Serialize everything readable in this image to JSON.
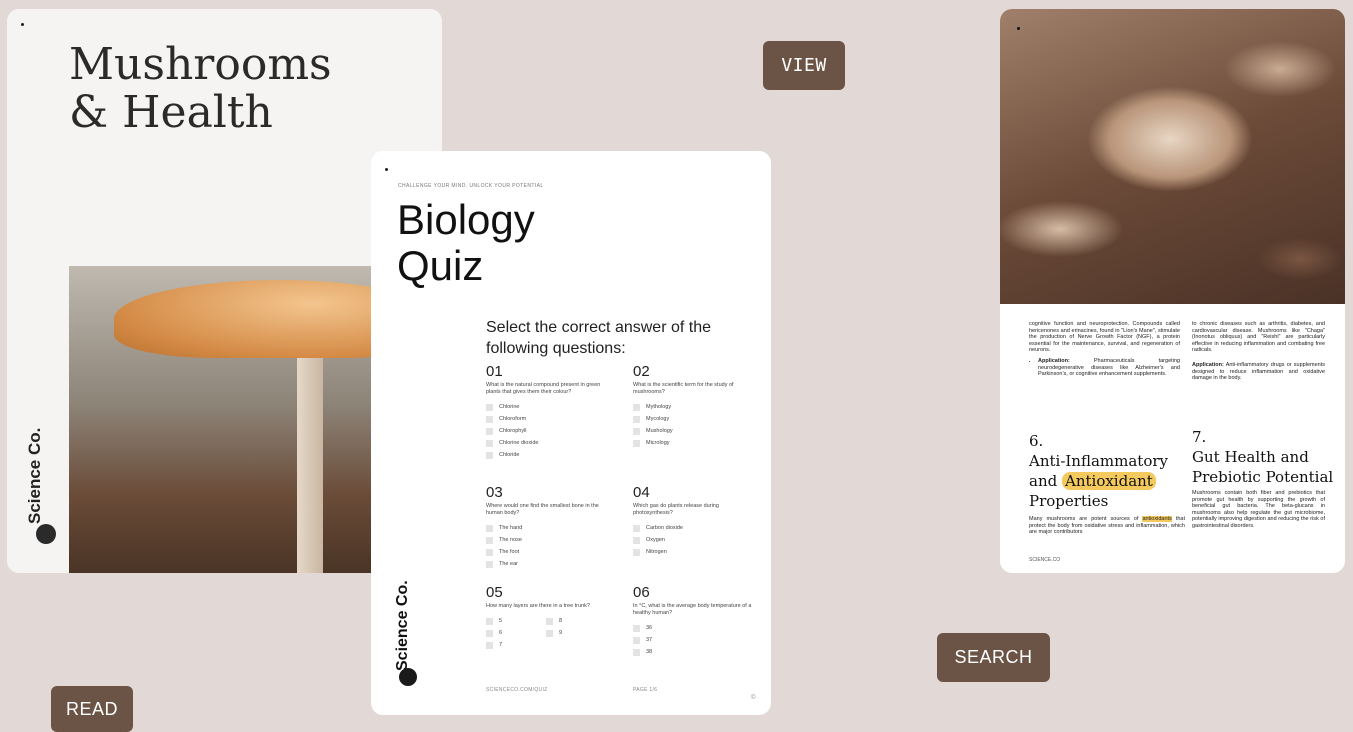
{
  "buttons": {
    "view": "VIEW",
    "search": "SEARCH",
    "read": "READ"
  },
  "card1": {
    "title_line1": "Mushrooms",
    "title_line2": "& Health",
    "brand": "Science Co."
  },
  "card2": {
    "tagline": "CHALLENGE YOUR MIND. UNLOCK YOUR POTENTIAL",
    "title_line1": "Biology",
    "title_line2": "Quiz",
    "intro": "Select the correct answer of the following questions:",
    "questions": [
      {
        "num": "01",
        "text": "What is the natural compound present in green plants that gives them their colour?",
        "options": [
          "Chlorine",
          "Chloroform",
          "Chlorophyll",
          "Chlorine dioxide",
          "Chloride"
        ]
      },
      {
        "num": "02",
        "text": "What is the scientific term for the study of mushrooms?",
        "options": [
          "Mythology",
          "Mycology",
          "Mushology",
          "Micrology"
        ]
      },
      {
        "num": "03",
        "text": "Where would one find the smallest bone in the human body?",
        "options": [
          "The hand",
          "The nose",
          "The foot",
          "The ear"
        ]
      },
      {
        "num": "04",
        "text": "Which gas do plants release during photosynthesis?",
        "options": [
          "Carbon dioxide",
          "Oxygen",
          "Nitrogen"
        ]
      },
      {
        "num": "05",
        "text": "How many layers are there in a tree trunk?",
        "options": [
          "5",
          "8",
          "6",
          "9",
          "7"
        ]
      },
      {
        "num": "06",
        "text": "In °C, what is the average body temperature of a healthy human?",
        "options": [
          "36",
          "37",
          "38"
        ]
      }
    ],
    "brand": "Science Co.",
    "footer_url": "SCIENCECO.COM/QUIZ",
    "footer_page": "PAGE 1/6",
    "footer_mark": "©"
  },
  "card3": {
    "col1_text": "cognitive function and neuroprotection. Compounds called hericenones and erinacines, found in \"Lion's Mane\", stimulate the production of Nerve Growth Factor (NGF), a protein essential for the maintenance, survival, and regeneration of neurons.",
    "col1_app_label": "Application:",
    "col1_app_text": "Pharmaceuticals targeting neurodegenerative diseases like Alzheimer's and Parkinson's, or cognitive enhancement supplements.",
    "col2_text": "to chronic diseases such as arthritis, diabetes, and cardiovascular disease. Mushrooms like \"Chaga\" (Inonotus obliquus) and \"Reishi\" are particularly effective in reducing inflammation and combating free radicals.",
    "col2_app_label": "Application:",
    "col2_app_text": "Anti-inflammatory drugs or supplements designed to reduce inflammation and oxidative damage in the body.",
    "sec6_num": "6.",
    "sec6_line1": "Anti-Inflammatory",
    "sec6_and": "and",
    "sec6_highlight": "Antioxidant",
    "sec6_line3": "Properties",
    "sec6_body_pre": "Many mushrooms are potent sources of",
    "sec6_body_hl": "antioxidants",
    "sec6_body_post": "that protect the body from oxidative stress and inflammation, which are major contributors",
    "sec7_num": "7.",
    "sec7_line1": "Gut Health and",
    "sec7_line2": "Prebiotic Potential",
    "sec7_body": "Mushrooms contain both fiber and prebiotics that promote gut health by supporting the growth of beneficial gut bacteria. The beta-glucans in mushrooms also help regulate the gut microbiome, potentially improving digestion and reducing the risk of gastrointestinal disorders.",
    "footer": "SCIENCE.CO"
  }
}
